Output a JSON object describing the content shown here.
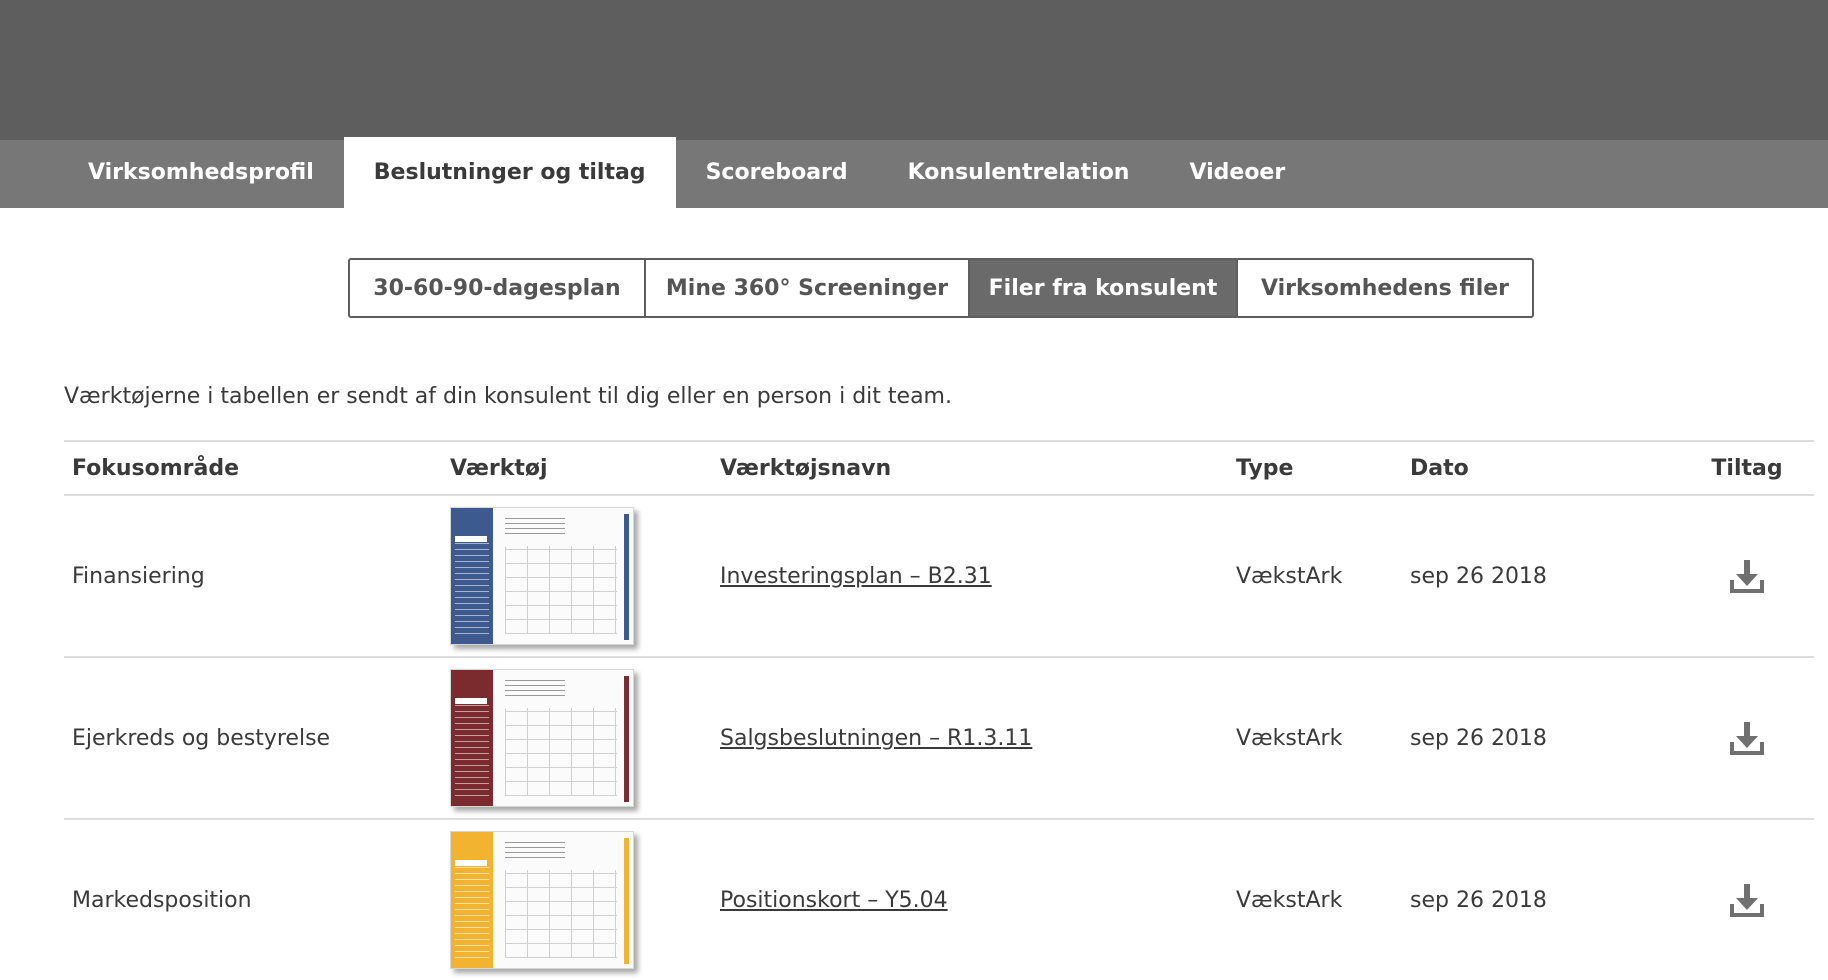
{
  "tabs": [
    {
      "label": "Virksomhedsprofil",
      "active": false
    },
    {
      "label": "Beslutninger og tiltag",
      "active": true
    },
    {
      "label": "Scoreboard",
      "active": false
    },
    {
      "label": "Konsulentrelation",
      "active": false
    },
    {
      "label": "Videoer",
      "active": false
    }
  ],
  "subtabs": [
    {
      "label": "30-60-90-dagesplan",
      "active": false
    },
    {
      "label": "Mine 360° Screeninger",
      "active": false
    },
    {
      "label": "Filer fra konsulent",
      "active": true
    },
    {
      "label": "Virksomhedens filer",
      "active": false
    }
  ],
  "intro_text": "Værktøjerne i tabellen er sendt af din konsulent til dig eller en person i dit team.",
  "table": {
    "headers": [
      "Fokusområde",
      "Værktøj",
      "Værktøjsnavn",
      "Type",
      "Dato",
      "Tiltag"
    ],
    "rows": [
      {
        "focus": "Finansiering",
        "tool_name": "Investeringsplan – B2.31",
        "type": "VækstArk",
        "date": "sep 26 2018",
        "thumb_color": "#3d5a8f",
        "action_icon": "download-icon"
      },
      {
        "focus": "Ejerkreds og bestyrelse",
        "tool_name": "Salgsbeslutningen – R1.3.11",
        "type": "VækstArk",
        "date": "sep 26 2018",
        "thumb_color": "#7b2b2e",
        "action_icon": "download-icon"
      },
      {
        "focus": "Markedsposition",
        "tool_name": "Positionskort – Y5.04",
        "type": "VækstArk",
        "date": "sep 26 2018",
        "thumb_color": "#f2b331",
        "action_icon": "download-icon"
      }
    ]
  },
  "colors": {
    "topbar": "#5e5e5e",
    "tabbar": "#777777",
    "active_segment": "#6a6a6a"
  }
}
